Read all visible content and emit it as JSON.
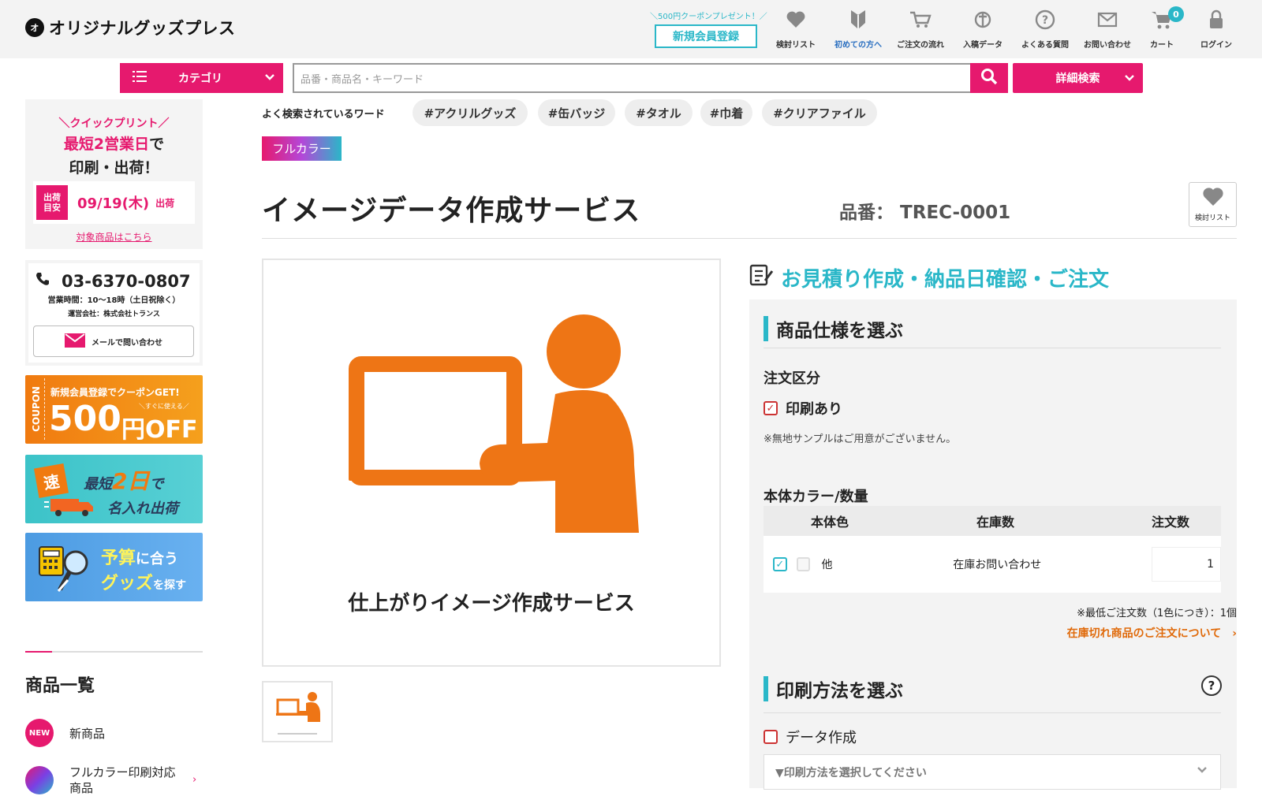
{
  "header": {
    "logo_text": "オリジナルグッズプレス",
    "logo_mark": "オ",
    "coupon_note": "＼500円クーポンプレゼント！／",
    "register_label": "新規会員登録",
    "nav": [
      {
        "label": "検討リスト",
        "icon": "heart-icon"
      },
      {
        "label": "初めての方へ",
        "icon": "beginner-mark-icon"
      },
      {
        "label": "ご注文の流れ",
        "icon": "cart-flow-icon"
      },
      {
        "label": "入稿データ",
        "icon": "data-upload-icon"
      },
      {
        "label": "よくある質問",
        "icon": "question-icon"
      },
      {
        "label": "お問い合わせ",
        "icon": "mail-icon"
      },
      {
        "label": "カート",
        "icon": "cart-icon"
      },
      {
        "label": "ログイン",
        "icon": "lock-icon"
      }
    ],
    "cart_count": "0",
    "accent_color": "#e6196e",
    "teal_color": "#2ab7c8"
  },
  "search": {
    "category_label": "カテゴリ",
    "placeholder": "品番・商品名・キーワード",
    "advanced_label": "詳細検索",
    "popular_label": "よく検索されているワード",
    "tags": [
      "#アクリルグッズ",
      "#缶バッジ",
      "#タオル",
      "#巾着",
      "#クリアファイル"
    ]
  },
  "sidebar": {
    "quick_print_title": "＼クイックプリント／",
    "quick_line1_red": "最短2営業日",
    "quick_line1_rest": "で",
    "quick_line2": "印刷・出荷！",
    "ship_tag_line1": "出荷",
    "ship_tag_line2": "目安",
    "ship_date": "09/19(木)",
    "ship_word": "出荷",
    "target_link": "対象商品はこちら",
    "phone": "03-6370-0807",
    "hours": "営業時間：10〜18時（土日祝除く）",
    "company": "運営会社：株式会社トランス",
    "mail_button": "メールで問い合わせ",
    "banner1_side": "COUPON",
    "banner1_top": "新規会員登録でクーポンGET!",
    "banner1_sub": "＼すぐに使える／",
    "banner1_big": "500",
    "banner1_unit": "円OFF",
    "banner2_badge": "速",
    "banner2_line1a": "最短",
    "banner2_line1b": "2日",
    "banner2_line1c": "で",
    "banner2_line2": "名入れ出荷",
    "banner3_line1a": "予算",
    "banner3_line1b": "に合う",
    "banner3_line2a": "グッズ",
    "banner3_line2b": "を探す",
    "products_title": "商品一覧",
    "new_badge": "NEW",
    "new_label": "新商品",
    "fullcolor_label": "フルカラー印刷対応商品"
  },
  "product": {
    "badge": "フルカラー",
    "title": "イメージデータ作成サービス",
    "sku_label": "品番：",
    "sku": "TREC-0001",
    "fav_label": "検討リスト",
    "image_caption": "仕上がりイメージ作成サービス",
    "illustration_color": "#ee7515"
  },
  "order": {
    "heading": "お見積り作成・納品日確認・ご注文",
    "spec_title": "商品仕様を選ぶ",
    "order_type_label": "注文区分",
    "print_option": "印刷あり",
    "no_sample_note": "※無地サンプルはご用意がございません。",
    "color_qty_label": "本体カラー/数量",
    "table_headers": [
      "本体色",
      "在庫数",
      "注文数"
    ],
    "rows": [
      {
        "color": "他",
        "stock": "在庫お問い合わせ",
        "qty": "1"
      }
    ],
    "min_order_note": "※最低ご注文数（1色につき）：1個",
    "oos_link": "在庫切れ商品のご注文について",
    "print_method_title": "印刷方法を選ぶ",
    "data_create_label": "データ作成",
    "method_placeholder": "▼印刷方法を選択してください"
  }
}
